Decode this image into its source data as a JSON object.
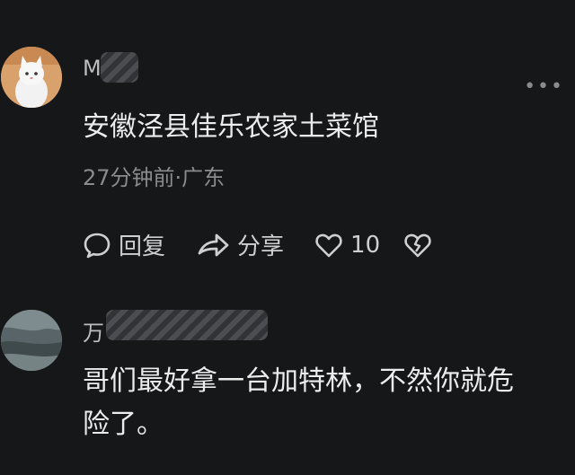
{
  "comments": [
    {
      "username_visible": "M",
      "text": "安徽泾县佳乐农家土菜馆",
      "meta": "27分钟前·广东",
      "actions": {
        "reply": "回复",
        "share": "分享",
        "likes": "10"
      },
      "more": "•••"
    },
    {
      "username_visible": "万",
      "text_line1": "哥们最好拿一台加特林，不然你就危",
      "text_line2": "险了。"
    }
  ],
  "icons": {
    "reply": "comment-bubble-icon",
    "share": "share-arrow-icon",
    "like": "heart-icon",
    "dislike": "broken-heart-icon",
    "more": "more-dots-icon"
  }
}
